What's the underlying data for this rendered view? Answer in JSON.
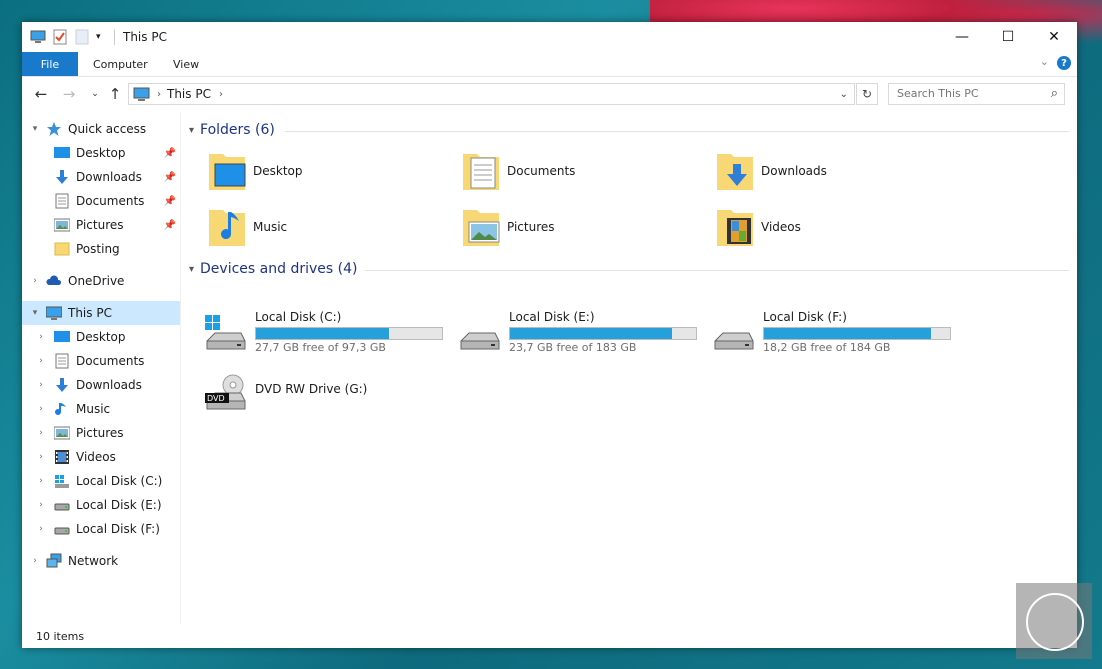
{
  "window": {
    "title": "This PC"
  },
  "ribbon": {
    "file": "File",
    "tabs": [
      "Computer",
      "View"
    ],
    "help": "?"
  },
  "address": {
    "path": "This PC"
  },
  "search": {
    "placeholder": "Search This PC"
  },
  "sidebar": {
    "quick_access": {
      "label": "Quick access",
      "items": [
        "Desktop",
        "Downloads",
        "Documents",
        "Pictures",
        "Posting"
      ]
    },
    "onedrive": "OneDrive",
    "this_pc": {
      "label": "This PC",
      "items": [
        "Desktop",
        "Documents",
        "Downloads",
        "Music",
        "Pictures",
        "Videos",
        "Local Disk (C:)",
        "Local Disk (E:)",
        "Local Disk (F:)"
      ]
    },
    "network": "Network"
  },
  "folders": {
    "header": "Folders (6)",
    "items": [
      "Desktop",
      "Documents",
      "Downloads",
      "Music",
      "Pictures",
      "Videos"
    ]
  },
  "devices": {
    "header": "Devices and drives (4)",
    "drives": [
      {
        "name": "Local Disk (C:)",
        "free": "27,7 GB free of 97,3 GB",
        "used_fraction": 0.715
      },
      {
        "name": "Local Disk (E:)",
        "free": "23,7 GB free of 183 GB",
        "used_fraction": 0.87
      },
      {
        "name": "Local Disk (F:)",
        "free": "18,2 GB free of 184 GB",
        "used_fraction": 0.9
      }
    ],
    "dvd": {
      "name": "DVD RW Drive (G:)",
      "badge": "DVD"
    }
  },
  "status": {
    "items": "10 items"
  },
  "colors": {
    "accent": "#1979ca",
    "drive_bar": "#26a0da",
    "group_header": "#1e3287",
    "selected": "#cce8ff"
  }
}
